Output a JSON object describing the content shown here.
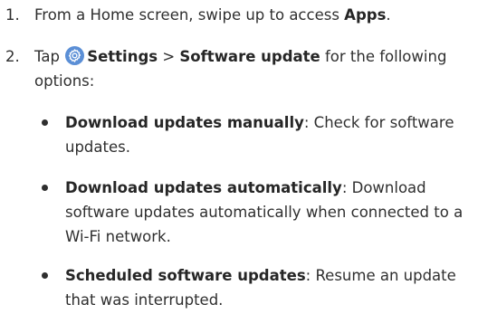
{
  "steps": [
    {
      "number": "1.",
      "text_before": "From a Home screen, swipe up to access ",
      "bold": "Apps",
      "text_after": "."
    },
    {
      "number": "2.",
      "text_before": "Tap ",
      "icon": "settings-gear-icon",
      "bold_settings": "Settings",
      "separator": " > ",
      "bold_update": "Software update",
      "text_after": " for the following options:"
    }
  ],
  "options": [
    {
      "title": "Download updates manually",
      "description": ": Check for software updates."
    },
    {
      "title": "Download updates automatically",
      "description": ": Download software updates automatically when connected to a Wi-Fi network."
    },
    {
      "title": "Scheduled software updates",
      "description": ": Resume an update that was interrupted."
    }
  ],
  "colors": {
    "text": "#2f2f2f",
    "settings_icon_bg": "#5b8fd6"
  }
}
